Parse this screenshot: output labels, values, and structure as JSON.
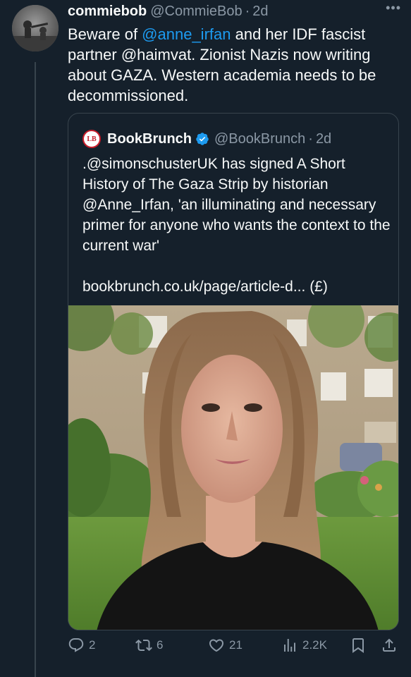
{
  "tweet": {
    "author_name": "commiebob",
    "author_handle": "@CommieBob",
    "separator": "·",
    "time": "2d",
    "more": "•••",
    "text_1": "Beware of ",
    "mention_1": "@anne_irfan",
    "text_2": "  and her IDF fascist partner @haimvat. Zionist Nazis now writing about GAZA. Western academia needs to be decommissioned."
  },
  "quote": {
    "logo_text": "LB",
    "author_name": "BookBrunch",
    "author_handle": "@BookBrunch",
    "separator": "·",
    "time": "2d",
    "text": ".@simonschusterUK has signed A Short History of The Gaza Strip by historian @Anne_Irfan, 'an illuminating and necessary primer for anyone who wants the context to the current war'",
    "link": "bookbrunch.co.uk/page/article-d... (£)"
  },
  "actions": {
    "replies": "2",
    "reposts": "6",
    "likes": "21",
    "views": "2.2K"
  },
  "colors": {
    "background": "#15202b",
    "text": "#f7f9f9",
    "muted": "#8b98a5",
    "accent": "#1d9bf0",
    "border": "#38444d"
  },
  "icons": [
    "more-icon",
    "verified-badge-icon",
    "reply-icon",
    "repost-icon",
    "like-icon",
    "views-icon",
    "bookmark-icon",
    "share-icon"
  ]
}
